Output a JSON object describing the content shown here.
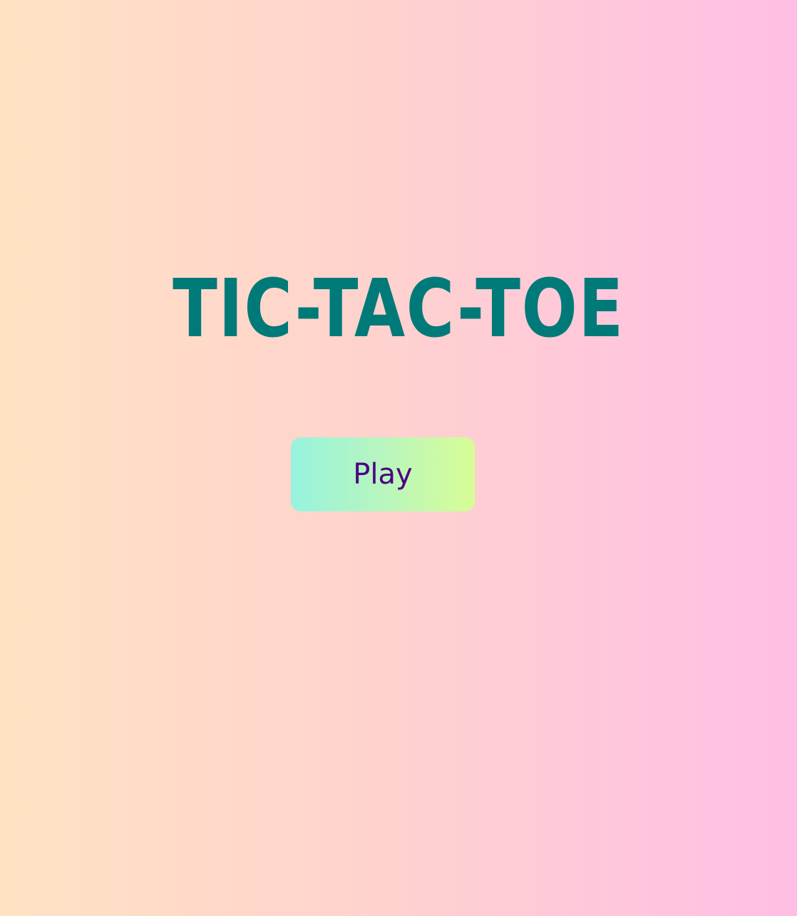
{
  "title": "TIC-TAC-TOE",
  "play_button": {
    "label": "Play"
  },
  "colors": {
    "title": "#007a78",
    "button_text": "#4b0082",
    "background_start": "#ffe2c3",
    "background_end": "#ffbee3",
    "button_gradient_start": "#97f3de",
    "button_gradient_end": "#d8fd95"
  }
}
